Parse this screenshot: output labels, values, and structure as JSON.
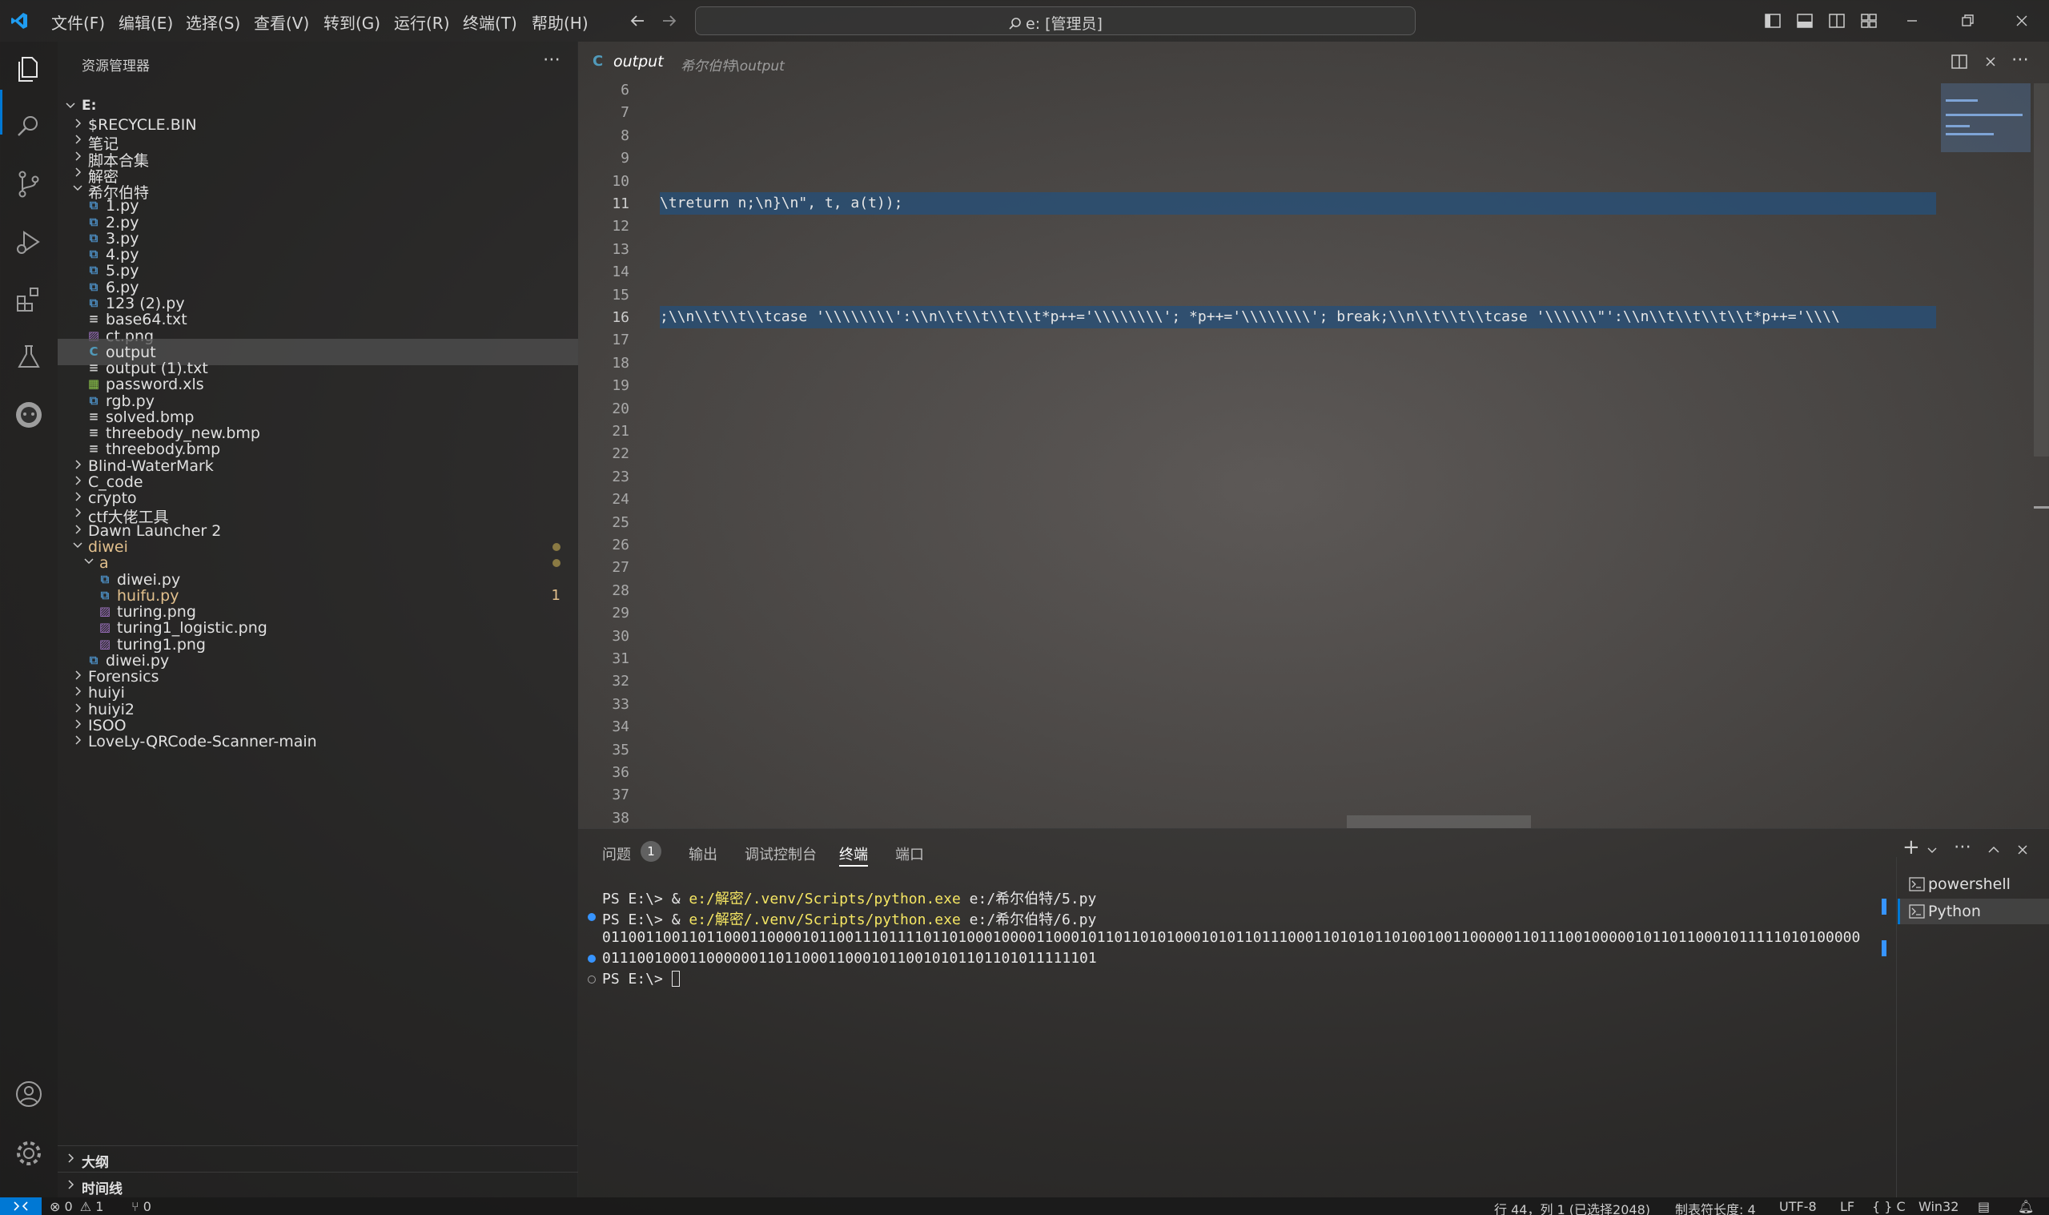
{
  "menu": [
    "文件(F)",
    "编辑(E)",
    "选择(S)",
    "查看(V)",
    "转到(G)",
    "运行(R)",
    "终端(T)",
    "帮助(H)"
  ],
  "command_center": "e: [管理员]",
  "sidebar": {
    "title": "资源管理器",
    "root": "E:",
    "items": [
      {
        "label": "$RECYCLE.BIN",
        "kind": "folder",
        "state": "collapsed"
      },
      {
        "label": "笔记",
        "kind": "folder",
        "state": "collapsed"
      },
      {
        "label": "脚本合集",
        "kind": "folder",
        "state": "collapsed"
      },
      {
        "label": "解密",
        "kind": "folder",
        "state": "collapsed"
      },
      {
        "label": "希尔伯特",
        "kind": "folder",
        "state": "expanded"
      },
      {
        "label": "1.py",
        "kind": "py"
      },
      {
        "label": "2.py",
        "kind": "py"
      },
      {
        "label": "3.py",
        "kind": "py"
      },
      {
        "label": "4.py",
        "kind": "py"
      },
      {
        "label": "5.py",
        "kind": "py"
      },
      {
        "label": "6.py",
        "kind": "py"
      },
      {
        "label": "123 (2).py",
        "kind": "py"
      },
      {
        "label": "base64.txt",
        "kind": "txt"
      },
      {
        "label": "ct.png",
        "kind": "img"
      },
      {
        "label": "output",
        "kind": "c",
        "selected": true
      },
      {
        "label": "output (1).txt",
        "kind": "txt"
      },
      {
        "label": "password.xls",
        "kind": "xls"
      },
      {
        "label": "rgb.py",
        "kind": "py"
      },
      {
        "label": "solved.bmp",
        "kind": "txt"
      },
      {
        "label": "threebody_new.bmp",
        "kind": "txt"
      },
      {
        "label": "threebody.bmp",
        "kind": "txt"
      },
      {
        "label": "Blind-WaterMark",
        "kind": "folder",
        "state": "collapsed"
      },
      {
        "label": "C_code",
        "kind": "folder",
        "state": "collapsed"
      },
      {
        "label": "crypto",
        "kind": "folder",
        "state": "collapsed"
      },
      {
        "label": "ctf大佬工具",
        "kind": "folder",
        "state": "collapsed"
      },
      {
        "label": "Dawn Launcher 2",
        "kind": "folder",
        "state": "collapsed"
      },
      {
        "label": "diwei",
        "kind": "folder",
        "state": "expanded",
        "modified": true
      },
      {
        "label": "a",
        "kind": "folder",
        "state": "expanded",
        "modified": true
      },
      {
        "label": "diwei.py",
        "kind": "py"
      },
      {
        "label": "huifu.py",
        "kind": "py",
        "modified": true,
        "count": "1"
      },
      {
        "label": "turing.png",
        "kind": "img"
      },
      {
        "label": "turing1_logistic.png",
        "kind": "img"
      },
      {
        "label": "turing1.png",
        "kind": "img"
      },
      {
        "label": "diwei.py",
        "kind": "py"
      },
      {
        "label": "Forensics",
        "kind": "folder",
        "state": "collapsed"
      },
      {
        "label": "huiyi",
        "kind": "folder",
        "state": "collapsed"
      },
      {
        "label": "huiyi2",
        "kind": "folder",
        "state": "collapsed"
      },
      {
        "label": "ISOO",
        "kind": "folder",
        "state": "collapsed"
      },
      {
        "label": "LoveLy-QRCode-Scanner-main",
        "kind": "folder",
        "state": "collapsed"
      }
    ],
    "outline": "大纲",
    "timeline": "时间线"
  },
  "editor": {
    "tab_icon": "C",
    "tab_title": "output",
    "tab_path": "希尔伯特\\output",
    "line_numbers": [
      "6",
      "7",
      "8",
      "9",
      "10",
      "11",
      "12",
      "13",
      "14",
      "15",
      "16",
      "17",
      "18",
      "19",
      "20",
      "21",
      "22",
      "23",
      "24",
      "25",
      "26",
      "27",
      "28",
      "29",
      "30",
      "31",
      "32",
      "33",
      "34",
      "35",
      "36",
      "37",
      "38"
    ],
    "line11": "\\treturn n;\\n}\\n\", t, a(t));",
    "line16": ";\\\\n\\\\t\\\\t\\\\tcase '\\\\\\\\\\\\\\\\':\\\\n\\\\t\\\\t\\\\t\\\\t*p++='\\\\\\\\\\\\\\\\'; *p++='\\\\\\\\\\\\\\\\'; break;\\\\n\\\\t\\\\t\\\\tcase '\\\\\\\\\\\\\"':\\\\n\\\\t\\\\t\\\\t\\\\t*p++='\\\\\\\\"
  },
  "panel": {
    "tabs": [
      "问题",
      "输出",
      "调试控制台",
      "终端",
      "端口"
    ],
    "problems_count": "1",
    "active_tab": "终端",
    "terminal": {
      "line1_prompt": "PS E:\\> & ",
      "line1_path": "e:/解密/.venv/Scripts/python.exe",
      "line1_arg": " e:/希尔伯特/5.py",
      "line2_prompt": "PS E:\\> & ",
      "line2_path": "e:/解密/.venv/Scripts/python.exe",
      "line2_arg": " e:/希尔伯特/6.py",
      "line3": "0110011001101100011000010110011101111011010001000011000101101101010001010110111000110101011010010011000001101110010000010110110001011111010100000",
      "line4": "011100100011000000110110001100010110010101101101011111101",
      "line5": "PS E:\\> "
    },
    "shells": [
      "powershell",
      "Python"
    ]
  },
  "statusbar": {
    "errors": "0",
    "warnings": "1",
    "ports": "0",
    "position": "行 44，列 1 (已选择2048)",
    "tab_size": "制表符长度: 4",
    "encoding": "UTF-8",
    "eol": "LF",
    "language": "C",
    "platform": "Win32"
  },
  "colors": {
    "accent": "#0078d4",
    "selection": "#264f78",
    "modified": "#e2c08d",
    "terminal_path": "#f5e663"
  }
}
